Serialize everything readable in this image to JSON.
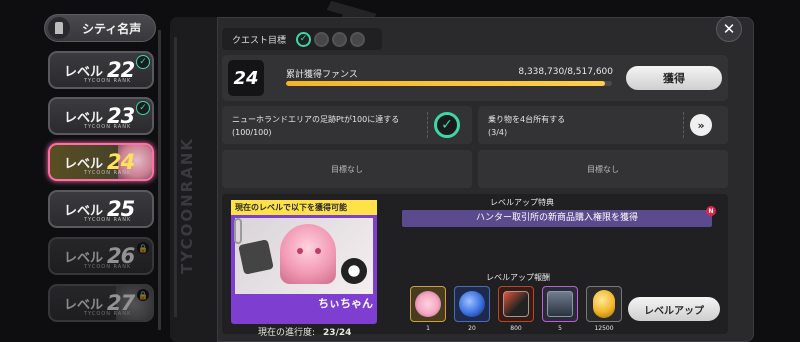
{
  "city": {
    "title": "シティ名声"
  },
  "levels": [
    {
      "label": "レベル",
      "num": "22",
      "rank": "TYCOON RANK",
      "state": "done"
    },
    {
      "label": "レベル",
      "num": "23",
      "rank": "TYCOON RANK",
      "state": "done"
    },
    {
      "label": "レベル",
      "num": "24",
      "rank": "TYCOON RANK",
      "state": "active"
    },
    {
      "label": "レベル",
      "num": "25",
      "rank": "TYCOON RANK",
      "state": "normal"
    },
    {
      "label": "レベル",
      "num": "26",
      "rank": "TYCOON RANK",
      "state": "locked"
    },
    {
      "label": "レベル",
      "num": "27",
      "rank": "TYCOON RANK",
      "state": "locked"
    }
  ],
  "sidebar": {
    "vertical_text": "TYCOONRANK"
  },
  "quest": {
    "label": "クエスト目標",
    "completed": 1,
    "total": 4
  },
  "fans": {
    "level": "24",
    "label": "累計獲得ファンス",
    "value_text": "8,338,730/8,517,600",
    "current": 8338730,
    "target": 8517600,
    "button": "獲得"
  },
  "goals": {
    "g1": {
      "line1": "ニューホランドエリアの足跡Ptが100に達する",
      "line2": "(100/100)",
      "icon": "check-icon"
    },
    "g2": {
      "line1": "乗り物を4台所有する",
      "line2": "(3/4)",
      "icon": "double-arrow-icon"
    },
    "g3": {
      "none": "目標なし"
    },
    "g4": {
      "none": "目標なし"
    }
  },
  "reward_card": {
    "header": "現在のレベルで以下を獲得可能",
    "name": "ちぃちゃん",
    "progress_label": "現在の進行度:",
    "progress_value": "23/24"
  },
  "perks": {
    "title": "レベルアップ特典",
    "item": "ハンター取引所の新商品購入権限を獲得",
    "badge": "N"
  },
  "rewards": {
    "title": "レベルアップ報酬",
    "items": [
      {
        "count": "1",
        "icon": "character-portrait-icon",
        "color": "#f3a7c2"
      },
      {
        "count": "20",
        "icon": "blue-orb-icon",
        "color": "#3b6fe0"
      },
      {
        "count": "800",
        "icon": "card-pack-icon",
        "color": "#e2563a"
      },
      {
        "count": "5",
        "icon": "crate-icon",
        "color": "#5a7fa6"
      },
      {
        "count": "12500",
        "icon": "gold-coin-icon",
        "color": "#f2b627"
      }
    ],
    "button": "レベルアップ"
  },
  "colors": {
    "accent": "#3fd6a6",
    "bar": "#f3b52a",
    "active_border": "#ff6fa8",
    "card": "#7e3fd0"
  }
}
